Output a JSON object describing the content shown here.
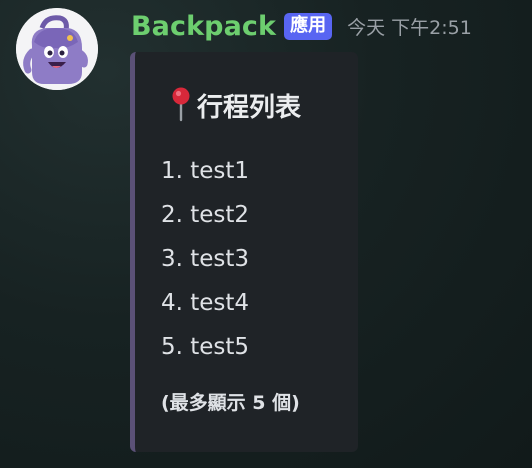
{
  "message": {
    "author": "Backpack",
    "badge": "應用",
    "timestamp": "今天 下午2:51"
  },
  "embed": {
    "accent_color": "#5b5177",
    "title_icon": "round-pushpin-icon",
    "title": "行程列表",
    "items": [
      "1. test1",
      "2. test2",
      "3. test3",
      "4. test4",
      "5. test5"
    ],
    "footer": "(最多顯示 5 個)"
  }
}
